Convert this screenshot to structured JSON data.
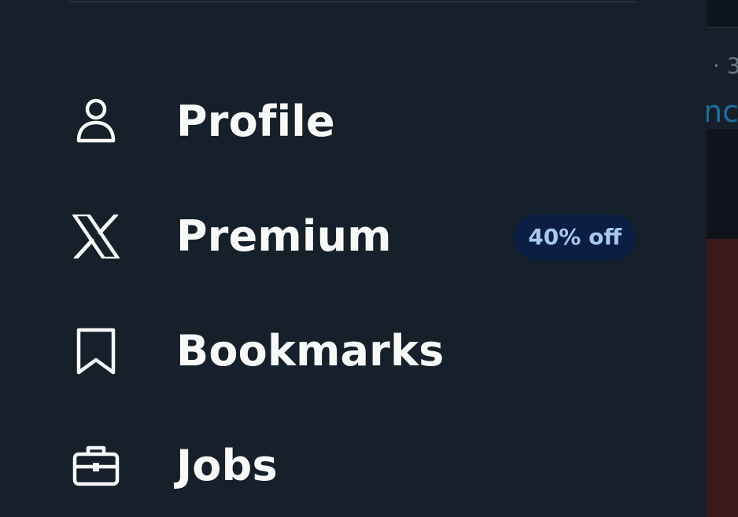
{
  "background": {
    "meta_text": "· 3",
    "link_text": "ncl"
  },
  "menu": {
    "items": [
      {
        "label": "Profile",
        "icon": "person-icon"
      },
      {
        "label": "Premium",
        "icon": "x-logo-icon",
        "badge": "40% off"
      },
      {
        "label": "Bookmarks",
        "icon": "bookmark-icon"
      },
      {
        "label": "Jobs",
        "icon": "briefcase-icon"
      }
    ]
  },
  "colors": {
    "drawer_bg": "#16202a",
    "text": "#f7f9f9",
    "badge_bg": "#0b1e43",
    "badge_text": "#a9c8ee"
  }
}
